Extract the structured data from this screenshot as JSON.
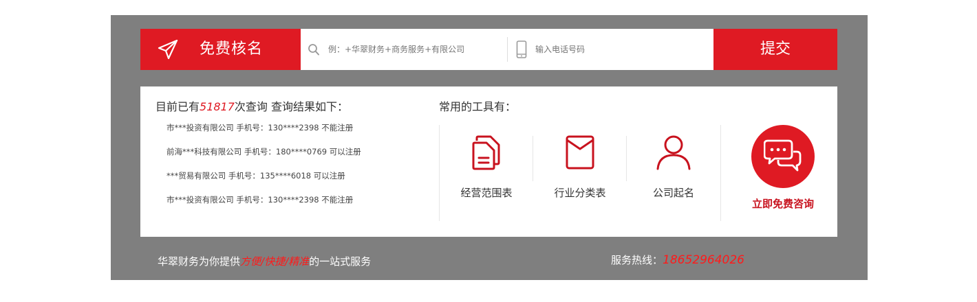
{
  "colors": {
    "accent": "#df1a23",
    "panel": "#7f7f7f"
  },
  "search_bar": {
    "brand_icon": "paper-plane-icon",
    "brand_title": "免费核名",
    "name_input": {
      "icon": "search-icon",
      "placeholder": "例：+华翠财务+商务服务+有限公司",
      "value": ""
    },
    "phone_input": {
      "icon": "mobile-phone-icon",
      "placeholder": "输入电话号码",
      "value": ""
    },
    "submit_label": "提交"
  },
  "query": {
    "prefix": "目前已有",
    "count": "51817",
    "suffix": "次查询 查询结果如下：",
    "results": [
      "市***投资有限公司 手机号：130****2398 不能注册",
      "前海***科技有限公司 手机号：180****0769 可以注册",
      "***贸易有限公司 手机号：135****6018 可以注册",
      "市***投资有限公司 手机号：130****2398 不能注册"
    ]
  },
  "tools": {
    "title": "常用的工具有：",
    "items": [
      {
        "icon": "document-copy-icon",
        "label": "经营范围表"
      },
      {
        "icon": "envelope-icon",
        "label": "行业分类表"
      },
      {
        "icon": "user-icon",
        "label": "公司起名"
      }
    ],
    "consult": {
      "icon": "chat-bubbles-icon",
      "label": "立即免费咨询"
    }
  },
  "footer": {
    "slogan_prefix": "华翠财务为你提供",
    "slogan_highlight": "方便/快捷/精准",
    "slogan_suffix": "的一站式服务",
    "hotline_label": "服务热线：",
    "hotline_number": "18652964026"
  }
}
